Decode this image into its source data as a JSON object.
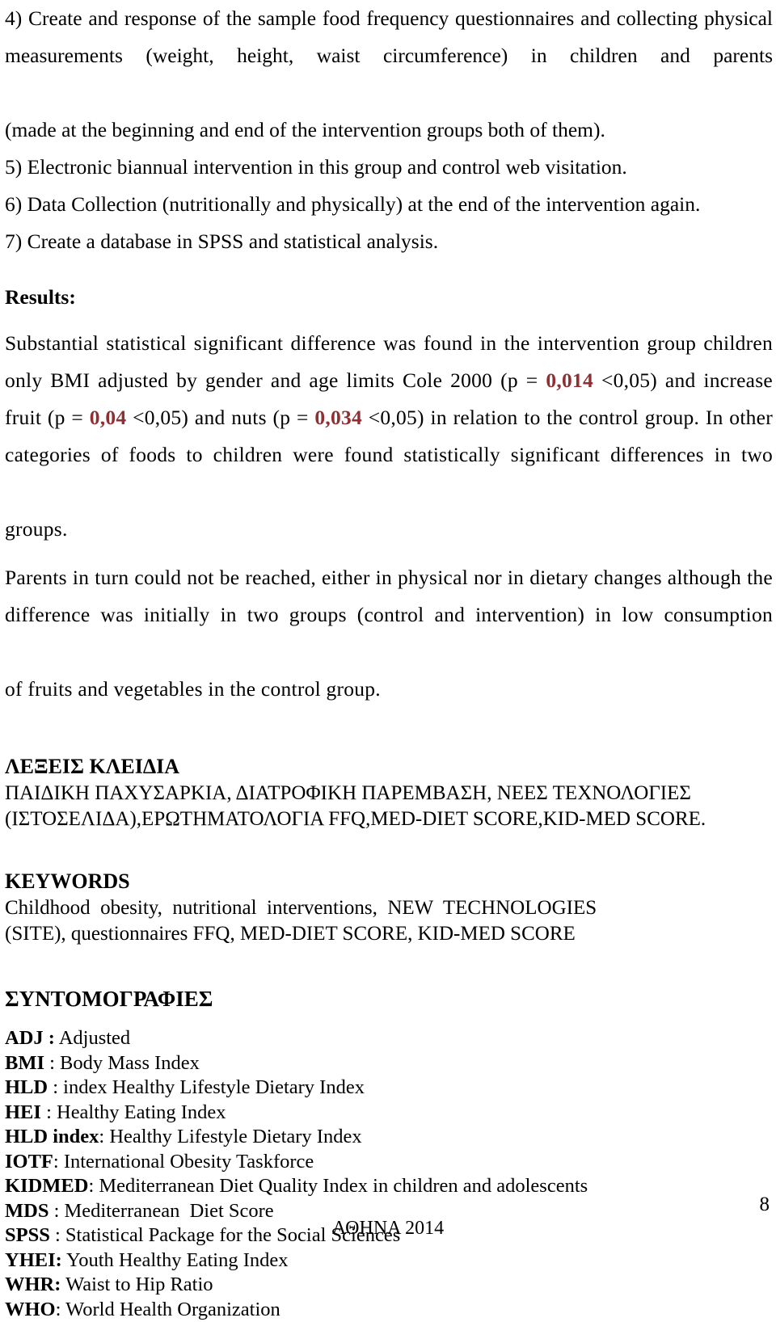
{
  "document": {
    "page_number": "8",
    "footer_center": "ΑΘΗΝΑ 2014",
    "accent_color": "#8E3033"
  },
  "methods_list": {
    "item4": "4) Create and response of the sample food frequency questionnaires and collecting physical measurements (weight, height, waist circumference) in children and parents",
    "item4_last_line": "(made at the beginning and end of the intervention groups both of them).",
    "item5": "5) Electronic biannual intervention in this group and control web visitation.",
    "item6": "6) Data Collection (nutritionally and physically) at the end of the intervention again.",
    "item7": "7) Create a database in SPSS and statistical analysis."
  },
  "results": {
    "heading": "Results:",
    "p1_part1": "Substantial statistical significant difference was found in the intervention group children only BMI adjusted by gender and age limits Cole 2000 (p = ",
    "p1_pval1": "0,014",
    "p1_part2": " <0,05) and increase fruit (p = ",
    "p1_pval2": "0,04",
    "p1_part3": " <0,05) and nuts (p = ",
    "p1_pval3": "0,034",
    "p1_part4": " <0,05) in relation to the control group. In other categories of foods to children were found statistically significant differences in two",
    "p1_last_line": "groups.",
    "p2_part1": "Parents in turn could not be reached, either in physical nor in dietary changes although the difference was initially in two groups (control and intervention) in low consumption",
    "p2_last_line": "of fruits and vegetables in the control group."
  },
  "keywords_greek": {
    "heading": "ΛΕΞΕΙΣ ΚΛΕΙΔΙΑ",
    "lines": [
      "ΠΑΙΔΙΚΗ ΠΑΧΥΣΑΡΚΙΑ, ΔΙΑΤΡΟΦΙΚΗ ΠΑΡΕΜΒΑΣΗ, ΝΕΕΣ ΤΕΧΝΟΛΟΓΙΕΣ",
      "(ΙΣΤΟΣΕΛΙΔΑ),ΕΡΩΤΗΜΑΤΟΛΟΓΙΑ FFQ,MED-DIET SCORE,KID-MED SCORE."
    ]
  },
  "keywords_english": {
    "heading": "KEYWORDS",
    "lines": [
      "Childhood  obesity,  nutritional  interventions,  NEW  TECHNOLOGIES",
      "(SITE), questionnaires FFQ, MED-DIET SCORE, KID-MED SCORE"
    ]
  },
  "abbreviations": {
    "heading": "ΣΥΝΤΟΜΟΓΡΑΦΙΕΣ",
    "items": [
      {
        "term": "ADJ :",
        "def": " Adjusted"
      },
      {
        "term": "BMI",
        "def": " : Body Mass Index"
      },
      {
        "term": "HLD",
        "def": " : index Healthy Lifestyle Dietary Index"
      },
      {
        "term": "HEI",
        "def": " : Healthy Eating Index"
      },
      {
        "term": "HLD index",
        "def": ": Healthy Lifestyle Dietary Index"
      },
      {
        "term": "IOTF",
        "def": ": International Obesity Taskforce"
      },
      {
        "term": "KIDMED",
        "def": ": Mediterranean Diet Quality Index in children and adolescents"
      },
      {
        "term": "MDS",
        "def": " : Mediterranean  Diet Score"
      },
      {
        "term": "SPSS",
        "def": " : Statistical Package for the Social Sciences"
      },
      {
        "term": "YHEI:",
        "def": " Youth Healthy Eating Index"
      },
      {
        "term": "WHR:",
        "def": " Waist to Hip Ratio"
      },
      {
        "term": "WHO",
        "def": ": World Health Organization"
      }
    ]
  }
}
